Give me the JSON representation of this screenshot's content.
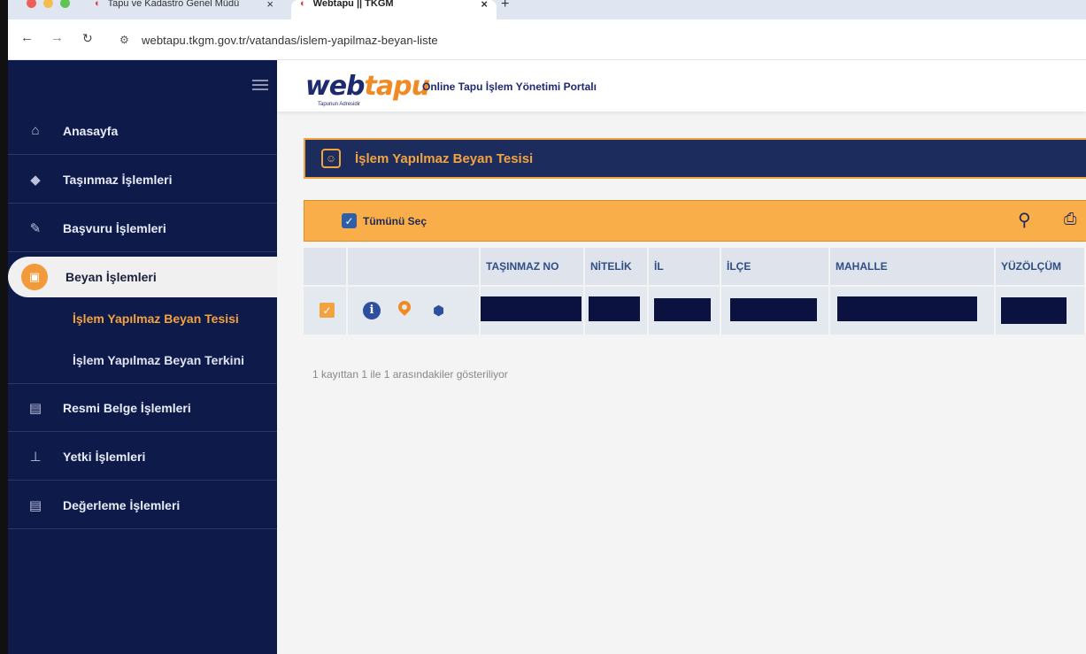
{
  "browser": {
    "tabs": [
      {
        "title": "Tapu ve Kadastro Genel Müdü",
        "active": false
      },
      {
        "title": "Webtapu || TKGM",
        "active": true
      }
    ],
    "url": "webtapu.tkgm.gov.tr/vatandas/islem-yapilmaz-beyan-liste"
  },
  "header": {
    "logo_web": "web",
    "logo_tapu": "tapu",
    "logo_tagline": "Tapunun Adresidir",
    "portal_title": "Online Tapu İşlem Yönetimi Portalı"
  },
  "sidebar": {
    "items": [
      {
        "label": "Anasayfa",
        "icon": "home-icon"
      },
      {
        "label": "Taşınmaz İşlemleri",
        "icon": "property-icon"
      },
      {
        "label": "Başvuru İşlemleri",
        "icon": "pen-icon"
      },
      {
        "label": "Beyan İşlemleri",
        "icon": "briefcase-icon"
      },
      {
        "label": "Resmi Belge İşlemleri",
        "icon": "document-icon"
      },
      {
        "label": "Yetki İşlemleri",
        "icon": "stamp-icon"
      },
      {
        "label": "Değerleme İşlemleri",
        "icon": "document-icon"
      }
    ],
    "submenu": [
      {
        "label": "İşlem Yapılmaz Beyan Tesisi",
        "active": true
      },
      {
        "label": "İşlem Yapılmaz Beyan Terkini",
        "active": false
      }
    ]
  },
  "page": {
    "title": "İşlem Yapılmaz Beyan Tesisi",
    "select_all_label": "Tümünü Seç",
    "columns": [
      "TAŞINMAZ NO",
      "NİTELİK",
      "İL",
      "İLÇE",
      "MAHALLE",
      "YÜZÖLÇÜM"
    ],
    "footer_text": "1 kayıttan 1 ile 1 arasındakiler gösteriliyor"
  },
  "colors": {
    "sidebar_bg": "#0e1a4a",
    "accent": "#f2a341",
    "header_bg": "#1c2c5c"
  }
}
